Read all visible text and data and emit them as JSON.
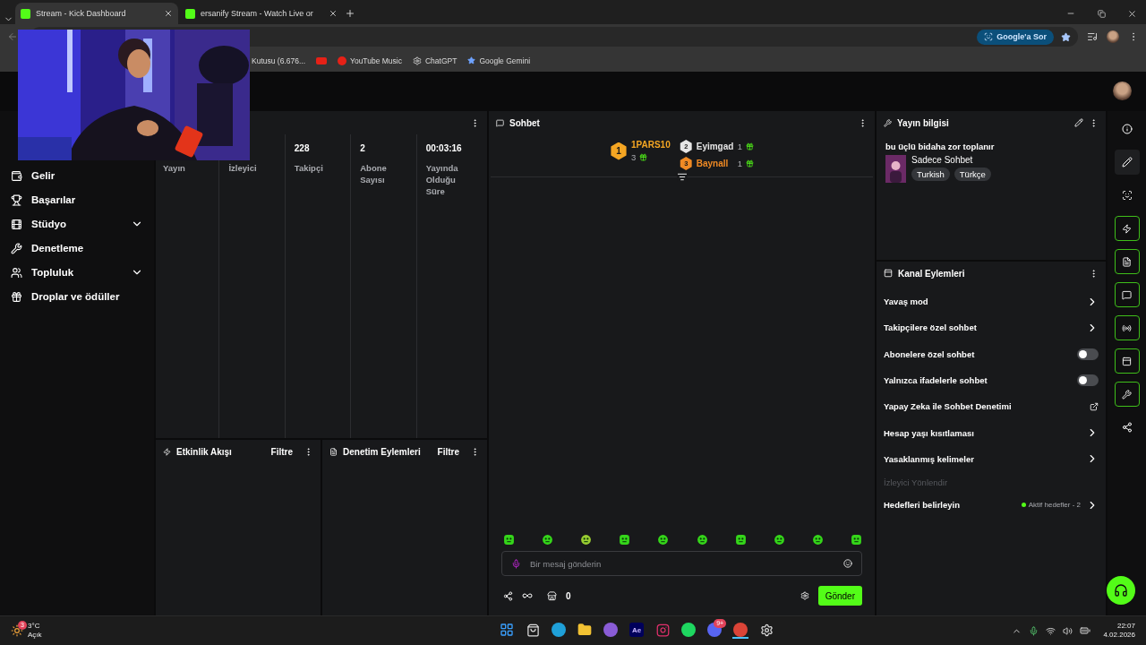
{
  "browser": {
    "tabs": [
      {
        "title": "Stream - Kick Dashboard",
        "selected": true
      },
      {
        "title": "ersanify Stream - Watch Live or",
        "selected": false
      }
    ],
    "ask_button": "Google'a Sor",
    "bookmarks": [
      {
        "kind": "text",
        "label": "Kutusu (6.676..."
      },
      {
        "kind": "youtube"
      },
      {
        "kind": "youtube-music",
        "label": "YouTube Music"
      },
      {
        "kind": "chatgpt",
        "label": "ChatGPT"
      },
      {
        "kind": "gemini",
        "label": "Google Gemini"
      }
    ]
  },
  "sidebar": {
    "items": [
      {
        "kind": "revenue",
        "label": "Gelir",
        "expandable": false
      },
      {
        "kind": "achievements",
        "label": "Başarılar",
        "expandable": false
      },
      {
        "kind": "studio",
        "label": "Stüdyo",
        "expandable": true
      },
      {
        "kind": "moderation",
        "label": "Denetleme",
        "expandable": false
      },
      {
        "kind": "community",
        "label": "Topluluk",
        "expandable": true
      },
      {
        "kind": "drops",
        "label": "Droplar ve ödüller",
        "expandable": false
      }
    ]
  },
  "stats": {
    "columns": [
      {
        "label": "Yayın"
      },
      {
        "label": "İzleyici"
      },
      {
        "value": "228",
        "label": "Takipçi"
      },
      {
        "value": "2",
        "label": "Abone Sayısı"
      },
      {
        "value": "00:03:16",
        "label": "Yayında Olduğu Süre"
      }
    ]
  },
  "event_feed": {
    "title": "Etkinlik Akışı",
    "filter": "Filtre"
  },
  "mod_actions": {
    "title": "Denetim Eylemleri",
    "filter": "Filtre"
  },
  "chat": {
    "title": "Sohbet",
    "leaders": [
      {
        "rank": "1",
        "name": "1PARS10",
        "count": "3",
        "color": "#f5a623"
      },
      {
        "rank": "2",
        "name": "Eyimgad",
        "count": "1",
        "color": "#e6e6e6"
      },
      {
        "rank": "3",
        "name": "Baynall",
        "count": "1",
        "color": "#f08a24"
      }
    ],
    "placeholder": "Bir mesaj gönderin",
    "points": "0",
    "send": "Gönder"
  },
  "stream_info": {
    "title": "Yayın bilgisi",
    "stream_title": "bu üçlü bidaha zor toplanır",
    "category": "Sadece Sohbet",
    "tags": [
      "Turkish",
      "Türkçe"
    ]
  },
  "channel_actions": {
    "title": "Kanal Eylemleri",
    "rows": [
      {
        "kind": "link",
        "label": "Yavaş mod"
      },
      {
        "kind": "link",
        "label": "Takipçilere özel sohbet"
      },
      {
        "kind": "toggle",
        "label": "Abonelere özel sohbet",
        "on": false
      },
      {
        "kind": "toggle",
        "label": "Yalnızca ifadelerle sohbet",
        "on": false
      },
      {
        "kind": "external",
        "label": "Yapay Zeka ile Sohbet Denetimi"
      },
      {
        "kind": "link",
        "label": "Hesap yaşı kısıtlaması"
      },
      {
        "kind": "link",
        "label": "Yasaklanmış kelimeler"
      },
      {
        "kind": "section",
        "label": "İzleyici Yönlendir"
      },
      {
        "kind": "goals",
        "label": "Hedefleri belirleyin",
        "status": "Aktif hedefler - 2"
      }
    ]
  },
  "rail": [
    {
      "kind": "info",
      "selected": false,
      "active": false
    },
    {
      "kind": "edit",
      "selected": true,
      "active": false
    },
    {
      "kind": "camera",
      "selected": false,
      "active": false
    },
    {
      "kind": "events",
      "selected": false,
      "active": true
    },
    {
      "kind": "notes",
      "selected": false,
      "active": true
    },
    {
      "kind": "chat",
      "selected": false,
      "active": true
    },
    {
      "kind": "broadcast",
      "selected": false,
      "active": true
    },
    {
      "kind": "layout",
      "selected": false,
      "active": true
    },
    {
      "kind": "moderation",
      "selected": false,
      "active": true
    },
    {
      "kind": "nodes",
      "selected": false,
      "active": false
    }
  ],
  "taskbar": {
    "weather_badge": "3",
    "temperature": "3°C",
    "condition": "Açık",
    "apps": [
      {
        "kind": "start",
        "selected": false
      },
      {
        "kind": "store",
        "selected": false
      },
      {
        "kind": "edge",
        "selected": false
      },
      {
        "kind": "files",
        "selected": false
      },
      {
        "kind": "vs",
        "selected": false
      },
      {
        "kind": "ae",
        "label": "Ae",
        "selected": false
      },
      {
        "kind": "instagram",
        "selected": false
      },
      {
        "kind": "spotify",
        "selected": false
      },
      {
        "kind": "discord",
        "badge": "9+",
        "selected": false
      },
      {
        "kind": "chrome",
        "selected": true
      },
      {
        "kind": "gear",
        "selected": false
      }
    ],
    "time": "22:07",
    "date": "4.02.2026"
  }
}
